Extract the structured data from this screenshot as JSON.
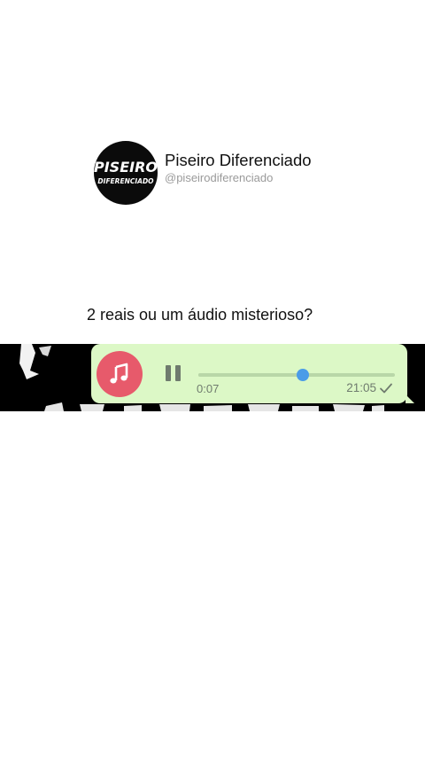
{
  "profile": {
    "avatar_logo_line1": "PISEIRO",
    "avatar_logo_line2": "DIFERENCIADO",
    "name": "Piseiro Diferenciado",
    "handle": "@piseirodiferenciado"
  },
  "post": {
    "caption": "2 reais ou um áudio misterioso?"
  },
  "audio_message": {
    "icon": "music-note-icon",
    "state_icon": "pause-icon",
    "elapsed": "0:07",
    "progress_fraction": 0.53,
    "timestamp": "21:05",
    "status_icon": "check-icon"
  },
  "colors": {
    "bubble": "#dcf8c6",
    "music_avatar": "#e75a6b",
    "knob": "#4a9ce8"
  }
}
